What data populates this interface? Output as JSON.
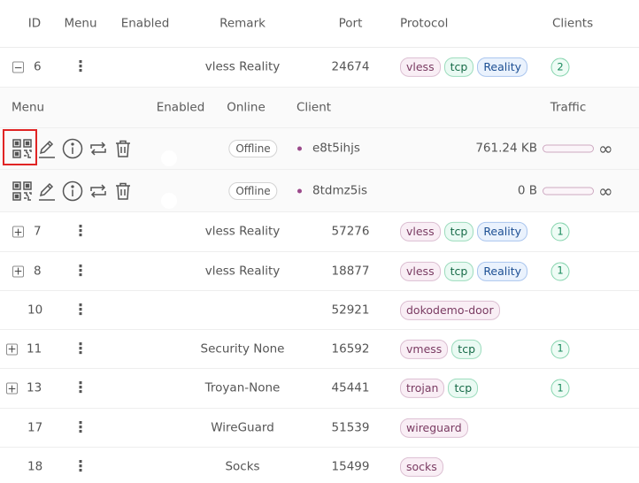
{
  "header": {
    "id": "ID",
    "menu": "Menu",
    "enabled": "Enabled",
    "remark": "Remark",
    "port": "Port",
    "protocol": "Protocol",
    "clients": "Clients"
  },
  "subheader": {
    "menu": "Menu",
    "enabled": "Enabled",
    "online": "Online",
    "client": "Client",
    "traffic": "Traffic"
  },
  "icons": {
    "expand": "plus-square-icon",
    "collapse": "minus-square-icon",
    "menu": "more-vertical-icon",
    "qr": "qrcode-icon",
    "edit": "edit-icon",
    "info": "info-circle-icon",
    "reset": "retweet-icon",
    "delete": "delete-icon"
  },
  "colors": {
    "toggle_on": "#0a7d5a",
    "highlight": "#e02424"
  },
  "inbounds": [
    {
      "id": "6",
      "expander": "−",
      "enabled": true,
      "remark": "vless Reality",
      "port": "24674",
      "tags": [
        "vless",
        "tcp",
        "Reality"
      ],
      "clients": "2"
    },
    {
      "id": "7",
      "expander": "+",
      "enabled": true,
      "remark": "vless Reality",
      "port": "57276",
      "tags": [
        "vless",
        "tcp",
        "Reality"
      ],
      "clients": "1"
    },
    {
      "id": "8",
      "expander": "+",
      "enabled": true,
      "remark": "vless Reality",
      "port": "18877",
      "tags": [
        "vless",
        "tcp",
        "Reality"
      ],
      "clients": "1"
    },
    {
      "id": "10",
      "expander": "",
      "enabled": true,
      "remark": "",
      "port": "52921",
      "tags": [
        "dokodemo-door"
      ],
      "clients": ""
    },
    {
      "id": "11",
      "expander": "+",
      "enabled": true,
      "remark": "Security None",
      "port": "16592",
      "tags": [
        "vmess",
        "tcp"
      ],
      "clients": "1"
    },
    {
      "id": "13",
      "expander": "+",
      "enabled": true,
      "remark": "Troyan-None",
      "port": "45441",
      "tags": [
        "trojan",
        "tcp"
      ],
      "clients": "1"
    },
    {
      "id": "17",
      "expander": "",
      "enabled": true,
      "remark": "WireGuard",
      "port": "51539",
      "tags": [
        "wireguard"
      ],
      "clients": ""
    },
    {
      "id": "18",
      "expander": "",
      "enabled": true,
      "remark": "Socks",
      "port": "15499",
      "tags": [
        "socks"
      ],
      "clients": ""
    }
  ],
  "clients": [
    {
      "enabled": true,
      "online": "Offline",
      "name": "e8t5ihjs",
      "traffic": "761.24 KB",
      "limit": "∞",
      "traffic_used_fraction": 0
    },
    {
      "enabled": true,
      "online": "Offline",
      "name": "8tdmz5is",
      "traffic": "0 B",
      "limit": "∞",
      "traffic_used_fraction": 0
    }
  ]
}
